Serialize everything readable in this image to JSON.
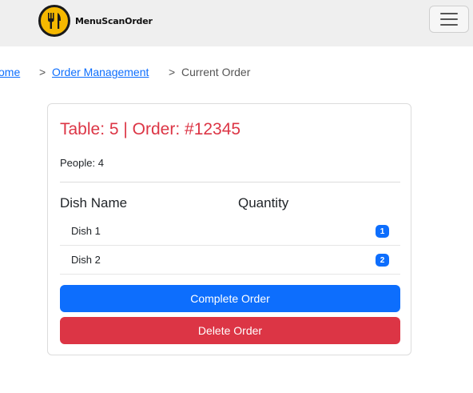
{
  "header": {
    "logo_text": "MenuScanOrder",
    "menu_icon": "hamburger-menu-icon"
  },
  "breadcrumb": {
    "home": "ome",
    "separator_1": ">",
    "order_management": "Order Management",
    "separator_2": ">",
    "current": "Current Order"
  },
  "order": {
    "title": "Table: 5 | Order: #12345",
    "people": "People: 4",
    "columns": {
      "dish": "Dish Name",
      "quantity": "Quantity"
    },
    "items": [
      {
        "name": "Dish 1",
        "qty": "1"
      },
      {
        "name": "Dish 2",
        "qty": "2"
      }
    ],
    "complete_label": "Complete Order",
    "delete_label": "Delete Order"
  },
  "colors": {
    "primary": "#0d6efd",
    "danger": "#dc3545",
    "logo_yellow": "#f5b800"
  }
}
